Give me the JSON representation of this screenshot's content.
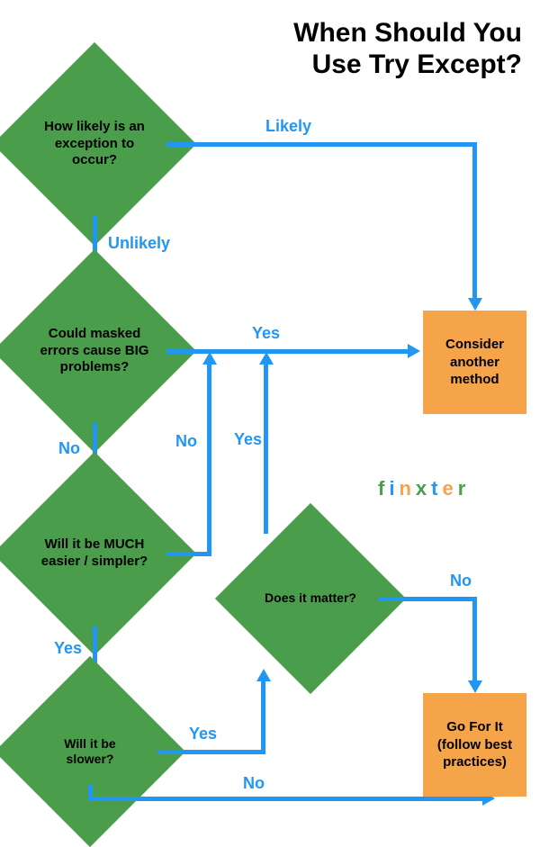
{
  "title_line1": "When Should You",
  "title_line2": "Use Try Except?",
  "nodes": {
    "d1": "How likely is an exception to occur?",
    "d2": "Could masked errors cause BIG problems?",
    "d3": "Will it be MUCH easier / simpler?",
    "d4": "Does it matter?",
    "d5": "Will it be slower?",
    "b1": "Consider another method",
    "b2": "Go For It (follow best practices)"
  },
  "edges": {
    "likely": "Likely",
    "unlikely": "Unlikely",
    "yes1": "Yes",
    "no1": "No",
    "no2": "No",
    "yes2": "Yes",
    "yes3": "Yes",
    "yes4": "Yes",
    "no3": "No",
    "no4": "No"
  },
  "logo": [
    "f",
    "i",
    "n",
    "x",
    "t",
    "e",
    "r"
  ]
}
